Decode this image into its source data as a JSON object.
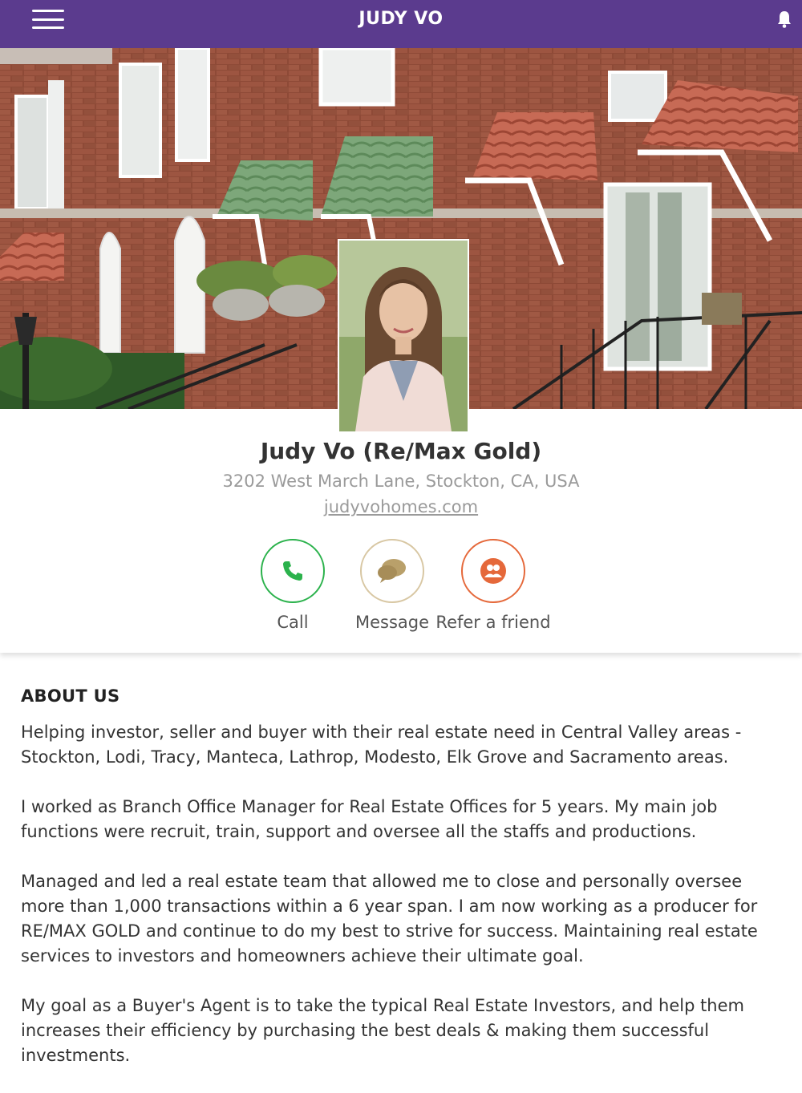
{
  "header": {
    "title": "JUDY VO",
    "menu_icon": "hamburger-menu-icon",
    "bell_icon": "bell-icon",
    "bg_color": "#5b3b8e"
  },
  "profile": {
    "name": "Judy Vo (Re/Max Gold)",
    "address": "3202 West March Lane, Stockton, CA, USA",
    "website": "judyvohomes.com"
  },
  "actions": [
    {
      "label": "Call",
      "icon": "phone-icon",
      "color": "#2bb24c"
    },
    {
      "label": "Message",
      "icon": "chat-bubbles-icon",
      "color": "#b9a06a"
    },
    {
      "label": "Refer a friend",
      "icon": "people-icon",
      "color": "#e5683a"
    }
  ],
  "about": {
    "heading": "ABOUT US",
    "paragraphs": [
      "Helping investor, seller and buyer with their real estate need in Central Valley areas - Stockton, Lodi, Tracy, Manteca, Lathrop, Modesto, Elk Grove and Sacramento areas.",
      "I worked as Branch Office Manager for Real Estate Offices for 5 years. My main job functions were recruit, train, support and oversee all the staffs and productions.",
      "Managed and led a real estate team that allowed me to close and personally oversee more than 1,000 transactions within a 6 year span. I am now working as a producer for RE/MAX GOLD and continue to do my best to strive for success. Maintaining real estate services to investors and homeowners achieve their ultimate goal.",
      "My goal as a Buyer's Agent is to take the typical Real Estate Investors, and help them increases their efficiency by purchasing the best deals & making them successful investments."
    ]
  }
}
